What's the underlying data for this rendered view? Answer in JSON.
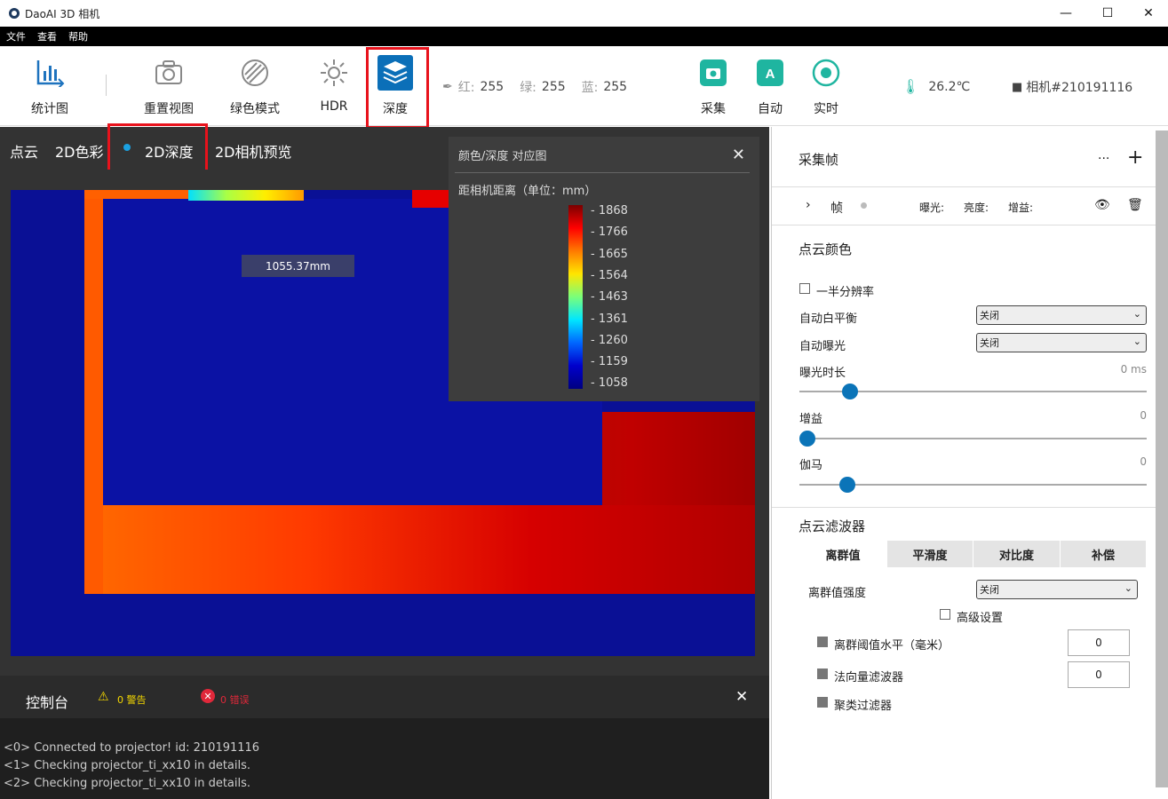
{
  "window": {
    "title": "DaoAI 3D 相机",
    "minimize": "—",
    "maximize": "☐",
    "close": "✕"
  },
  "menu": [
    "文件",
    "查看",
    "帮助"
  ],
  "toolbar": {
    "stats": "统计图",
    "reset_view": "重置视图",
    "green_mode": "绿色模式",
    "hdr": "HDR",
    "depth": "深度",
    "rgb": {
      "r_label": "红:",
      "r": "255",
      "g_label": "绿:",
      "g": "255",
      "b_label": "蓝:",
      "b": "255"
    },
    "capture": "采集",
    "auto": "自动",
    "realtime": "实时",
    "temperature": "26.2℃",
    "camera": "相机#210191116",
    "accent": "#1fb5a0"
  },
  "view_tabs": [
    "点云",
    "2D色彩",
    "2D深度",
    "2D相机预览"
  ],
  "active_tab": "2D深度",
  "depth_readout": "1055.37mm",
  "legend": {
    "title": "颜色/深度 对应图",
    "unit": "距相机距离（单位：mm）",
    "ticks": [
      "1868",
      "1766",
      "1665",
      "1564",
      "1463",
      "1361",
      "1260",
      "1159",
      "1058"
    ]
  },
  "console": {
    "title": "控制台",
    "warnings": "0 警告",
    "errors": "0 错误",
    "lines": [
      "<0> Connected to projector! id: 210191116",
      "<1> Checking projector_ti_xx10 in details.",
      "<2> Checking projector_ti_xx10 in details."
    ]
  },
  "panel": {
    "frames_title": "采集帧",
    "more": "···",
    "add": "+",
    "frame_row": {
      "label": "帧",
      "exposure": "曝光:",
      "brightness": "亮度:",
      "gain": "增益:"
    },
    "color_section": "点云颜色",
    "half_res": "一半分辨率",
    "awb_label": "自动白平衡",
    "awb_value": "关闭",
    "ae_label": "自动曝光",
    "ae_value": "关闭",
    "exposure_label": "曝光时长",
    "exposure_value": "0 ms",
    "exposure_level": 0.13,
    "gain_label": "增益",
    "gain_value": "0",
    "gain_level": 0.0,
    "gamma_label": "伽马",
    "gamma_value": "0",
    "gamma_level": 0.12,
    "filter_section": "点云滤波器",
    "filter_tabs": [
      "离群值",
      "平滑度",
      "对比度",
      "补偿"
    ],
    "outlier_strength_label": "离群值强度",
    "outlier_strength_value": "关闭",
    "advanced": "高级设置",
    "outlier_threshold_label": "离群阈值水平（毫米）",
    "outlier_threshold_value": "0",
    "normal_filter_label": "法向量滤波器",
    "normal_filter_value": "0",
    "cluster_filter_label": "聚类过滤器"
  }
}
